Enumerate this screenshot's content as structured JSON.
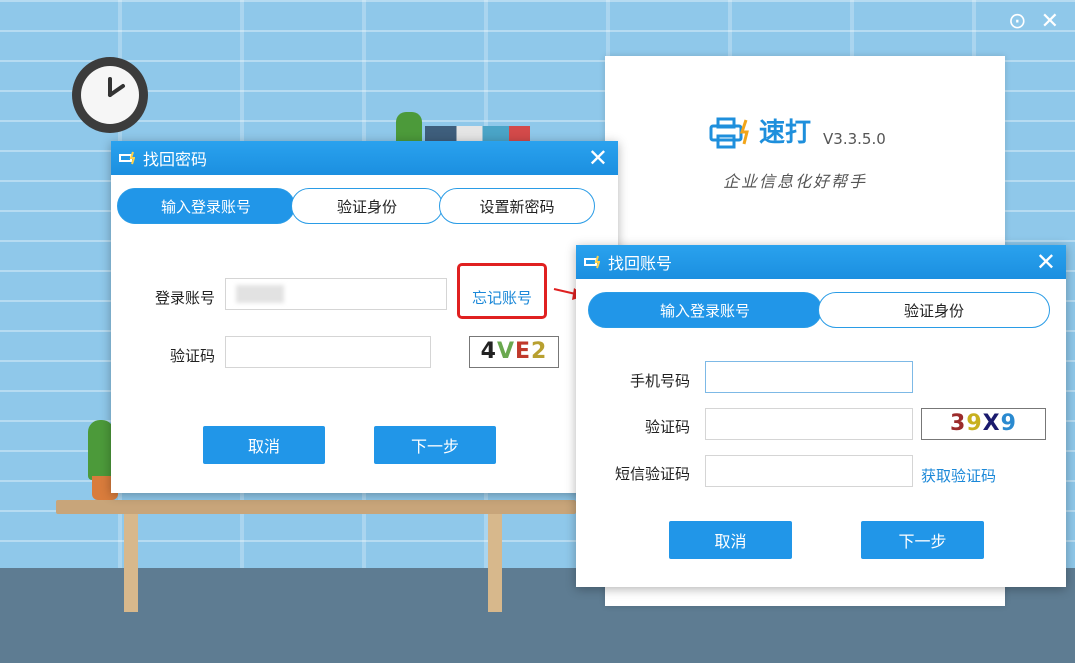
{
  "top_bar": {
    "settings_icon": "settings-icon",
    "close_icon": "close-icon",
    "settings_glyph": "⊙",
    "close_glyph": "✕"
  },
  "splash": {
    "brand": "速打",
    "version": "V3.3.5.0",
    "slogan": "企业信息化好帮手",
    "accent": "#1e8fdc"
  },
  "recover_password": {
    "title": "找回密码",
    "close_glyph": "✕",
    "steps": [
      "输入登录账号",
      "验证身份",
      "设置新密码"
    ],
    "account_label": "登录账号",
    "account_value": "",
    "forgot_account_link": "忘记账号",
    "captcha_label": "验证码",
    "captcha_value": "",
    "captcha_image": {
      "text": [
        "4",
        "V",
        "E",
        "2"
      ],
      "colors": [
        "#222222",
        "#6aa84f",
        "#c0392b",
        "#b8a030"
      ]
    },
    "cancel": "取消",
    "next": "下一步"
  },
  "recover_account": {
    "title": "找回账号",
    "close_glyph": "✕",
    "steps": [
      "输入登录账号",
      "验证身份"
    ],
    "phone_label": "手机号码",
    "phone_value": "",
    "captcha_label": "验证码",
    "captcha_value": "",
    "captcha_image": {
      "text": [
        "3",
        "9",
        "X",
        "9"
      ],
      "colors": [
        "#9b2b2b",
        "#c8b020",
        "#1a1a6e",
        "#2a8ad0"
      ]
    },
    "sms_label": "短信验证码",
    "sms_value": "",
    "get_code_link": "获取验证码",
    "cancel": "取消",
    "next": "下一步"
  },
  "colors": {
    "primary": "#2196e8",
    "highlight_box": "#e02020"
  }
}
